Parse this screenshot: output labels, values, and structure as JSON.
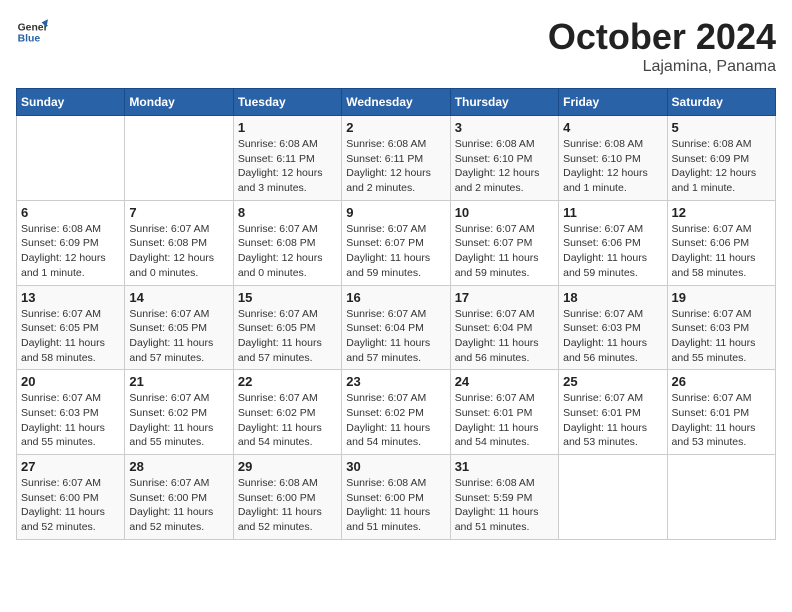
{
  "logo": {
    "line1": "General",
    "line2": "Blue"
  },
  "title": "October 2024",
  "subtitle": "Lajamina, Panama",
  "days_header": [
    "Sunday",
    "Monday",
    "Tuesday",
    "Wednesday",
    "Thursday",
    "Friday",
    "Saturday"
  ],
  "weeks": [
    [
      {
        "num": "",
        "info": ""
      },
      {
        "num": "",
        "info": ""
      },
      {
        "num": "1",
        "info": "Sunrise: 6:08 AM\nSunset: 6:11 PM\nDaylight: 12 hours\nand 3 minutes."
      },
      {
        "num": "2",
        "info": "Sunrise: 6:08 AM\nSunset: 6:11 PM\nDaylight: 12 hours\nand 2 minutes."
      },
      {
        "num": "3",
        "info": "Sunrise: 6:08 AM\nSunset: 6:10 PM\nDaylight: 12 hours\nand 2 minutes."
      },
      {
        "num": "4",
        "info": "Sunrise: 6:08 AM\nSunset: 6:10 PM\nDaylight: 12 hours\nand 1 minute."
      },
      {
        "num": "5",
        "info": "Sunrise: 6:08 AM\nSunset: 6:09 PM\nDaylight: 12 hours\nand 1 minute."
      }
    ],
    [
      {
        "num": "6",
        "info": "Sunrise: 6:08 AM\nSunset: 6:09 PM\nDaylight: 12 hours\nand 1 minute."
      },
      {
        "num": "7",
        "info": "Sunrise: 6:07 AM\nSunset: 6:08 PM\nDaylight: 12 hours\nand 0 minutes."
      },
      {
        "num": "8",
        "info": "Sunrise: 6:07 AM\nSunset: 6:08 PM\nDaylight: 12 hours\nand 0 minutes."
      },
      {
        "num": "9",
        "info": "Sunrise: 6:07 AM\nSunset: 6:07 PM\nDaylight: 11 hours\nand 59 minutes."
      },
      {
        "num": "10",
        "info": "Sunrise: 6:07 AM\nSunset: 6:07 PM\nDaylight: 11 hours\nand 59 minutes."
      },
      {
        "num": "11",
        "info": "Sunrise: 6:07 AM\nSunset: 6:06 PM\nDaylight: 11 hours\nand 59 minutes."
      },
      {
        "num": "12",
        "info": "Sunrise: 6:07 AM\nSunset: 6:06 PM\nDaylight: 11 hours\nand 58 minutes."
      }
    ],
    [
      {
        "num": "13",
        "info": "Sunrise: 6:07 AM\nSunset: 6:05 PM\nDaylight: 11 hours\nand 58 minutes."
      },
      {
        "num": "14",
        "info": "Sunrise: 6:07 AM\nSunset: 6:05 PM\nDaylight: 11 hours\nand 57 minutes."
      },
      {
        "num": "15",
        "info": "Sunrise: 6:07 AM\nSunset: 6:05 PM\nDaylight: 11 hours\nand 57 minutes."
      },
      {
        "num": "16",
        "info": "Sunrise: 6:07 AM\nSunset: 6:04 PM\nDaylight: 11 hours\nand 57 minutes."
      },
      {
        "num": "17",
        "info": "Sunrise: 6:07 AM\nSunset: 6:04 PM\nDaylight: 11 hours\nand 56 minutes."
      },
      {
        "num": "18",
        "info": "Sunrise: 6:07 AM\nSunset: 6:03 PM\nDaylight: 11 hours\nand 56 minutes."
      },
      {
        "num": "19",
        "info": "Sunrise: 6:07 AM\nSunset: 6:03 PM\nDaylight: 11 hours\nand 55 minutes."
      }
    ],
    [
      {
        "num": "20",
        "info": "Sunrise: 6:07 AM\nSunset: 6:03 PM\nDaylight: 11 hours\nand 55 minutes."
      },
      {
        "num": "21",
        "info": "Sunrise: 6:07 AM\nSunset: 6:02 PM\nDaylight: 11 hours\nand 55 minutes."
      },
      {
        "num": "22",
        "info": "Sunrise: 6:07 AM\nSunset: 6:02 PM\nDaylight: 11 hours\nand 54 minutes."
      },
      {
        "num": "23",
        "info": "Sunrise: 6:07 AM\nSunset: 6:02 PM\nDaylight: 11 hours\nand 54 minutes."
      },
      {
        "num": "24",
        "info": "Sunrise: 6:07 AM\nSunset: 6:01 PM\nDaylight: 11 hours\nand 54 minutes."
      },
      {
        "num": "25",
        "info": "Sunrise: 6:07 AM\nSunset: 6:01 PM\nDaylight: 11 hours\nand 53 minutes."
      },
      {
        "num": "26",
        "info": "Sunrise: 6:07 AM\nSunset: 6:01 PM\nDaylight: 11 hours\nand 53 minutes."
      }
    ],
    [
      {
        "num": "27",
        "info": "Sunrise: 6:07 AM\nSunset: 6:00 PM\nDaylight: 11 hours\nand 52 minutes."
      },
      {
        "num": "28",
        "info": "Sunrise: 6:07 AM\nSunset: 6:00 PM\nDaylight: 11 hours\nand 52 minutes."
      },
      {
        "num": "29",
        "info": "Sunrise: 6:08 AM\nSunset: 6:00 PM\nDaylight: 11 hours\nand 52 minutes."
      },
      {
        "num": "30",
        "info": "Sunrise: 6:08 AM\nSunset: 6:00 PM\nDaylight: 11 hours\nand 51 minutes."
      },
      {
        "num": "31",
        "info": "Sunrise: 6:08 AM\nSunset: 5:59 PM\nDaylight: 11 hours\nand 51 minutes."
      },
      {
        "num": "",
        "info": ""
      },
      {
        "num": "",
        "info": ""
      }
    ]
  ]
}
